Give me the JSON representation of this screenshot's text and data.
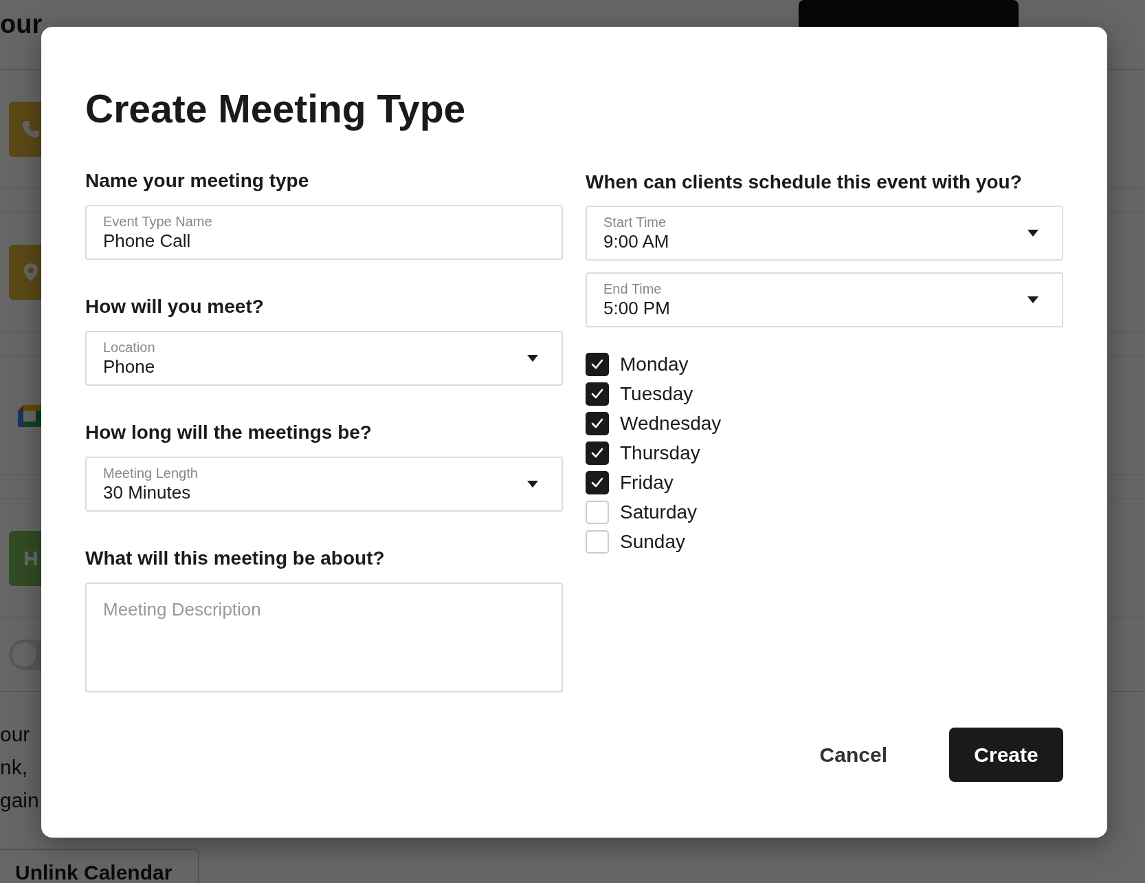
{
  "background": {
    "heading": "our",
    "rows": [
      {
        "kind": "phone"
      },
      {
        "kind": "pin"
      },
      {
        "kind": "meet"
      },
      {
        "kind": "letter"
      }
    ],
    "toggle": {
      "on": false
    },
    "text_lines": [
      "our",
      "nk,",
      "gain"
    ],
    "unlink_button": "Unlink Calendar"
  },
  "modal": {
    "title": "Create Meeting Type",
    "left": [
      {
        "kind": "text",
        "heading": "Name your meeting type",
        "label": "Event Type Name",
        "value": "Phone Call"
      },
      {
        "kind": "select",
        "heading": "How will you meet?",
        "label": "Location",
        "value": "Phone"
      },
      {
        "kind": "select",
        "heading": "How long will the meetings be?",
        "label": "Meeting Length",
        "value": "30 Minutes"
      },
      {
        "kind": "textarea",
        "heading": "What will this meeting be about?",
        "placeholder": "Meeting Description"
      }
    ],
    "right": {
      "heading": "When can clients schedule this event with you?",
      "selects": [
        {
          "label": "Start Time",
          "value": "9:00 AM"
        },
        {
          "label": "End Time",
          "value": "5:00 PM"
        }
      ],
      "days": [
        {
          "label": "Monday",
          "checked": true
        },
        {
          "label": "Tuesday",
          "checked": true
        },
        {
          "label": "Wednesday",
          "checked": true
        },
        {
          "label": "Thursday",
          "checked": true
        },
        {
          "label": "Friday",
          "checked": true
        },
        {
          "label": "Saturday",
          "checked": false
        },
        {
          "label": "Sunday",
          "checked": false
        }
      ]
    },
    "buttons": [
      {
        "label": "Cancel",
        "kind": "secondary"
      },
      {
        "label": "Create",
        "kind": "primary"
      }
    ]
  }
}
